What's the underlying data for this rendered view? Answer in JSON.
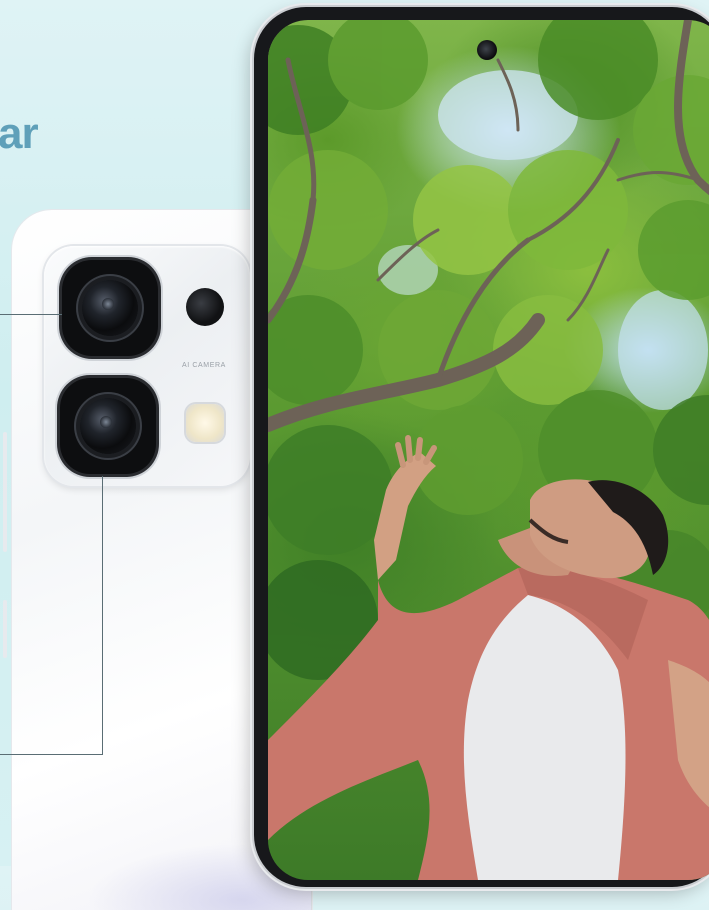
{
  "headline": {
    "text": "ar"
  },
  "camera_module": {
    "label": "AI CAMERA"
  },
  "colors": {
    "background": "#d7f1f3",
    "headline": "#5fa0b9",
    "callout_line": "#5a6d74",
    "phone_back": "#f4f6f8",
    "phone_frame": "#17181b"
  }
}
